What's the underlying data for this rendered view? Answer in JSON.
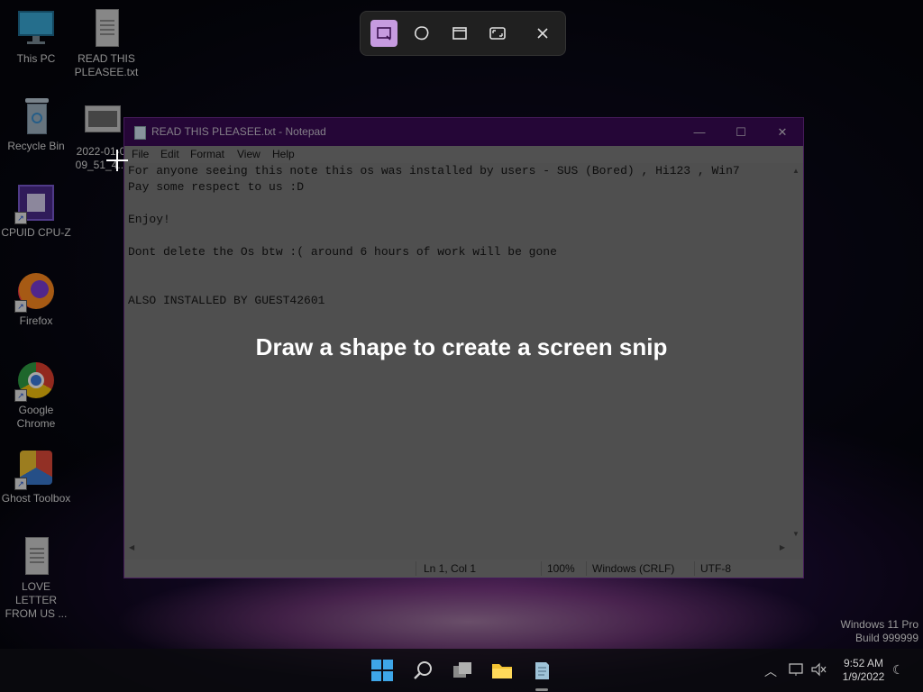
{
  "desktop": {
    "icons": [
      {
        "label": "This PC"
      },
      {
        "label": "READ THIS PLEASEE.txt"
      },
      {
        "label": "Recycle Bin"
      },
      {
        "label": "2022-01-0 09_51_4..."
      },
      {
        "label": "CPUID CPU-Z"
      },
      {
        "label": "Firefox"
      },
      {
        "label": "Google Chrome"
      },
      {
        "label": "Ghost Toolbox"
      },
      {
        "label": "LOVE LETTER FROM US ..."
      }
    ]
  },
  "notepad": {
    "title": "READ THIS PLEASEE.txt - Notepad",
    "menu": [
      "File",
      "Edit",
      "Format",
      "View",
      "Help"
    ],
    "content": "For anyone seeing this note this os was installed by users - SUS (Bored) , Hi123 , Win7\nPay some respect to us :D\n\nEnjoy!\n\nDont delete the Os btw :( around 6 hours of work will be gone\n\n\nALSO INSTALLED BY GUEST42601",
    "status": {
      "position": "Ln 1, Col 1",
      "zoom": "100%",
      "line_ending": "Windows (CRLF)",
      "encoding": "UTF-8"
    },
    "buttons": {
      "minimize": "—",
      "maximize": "☐",
      "close": "✕"
    }
  },
  "snip": {
    "hint": "Draw a shape to create a screen snip",
    "tools": [
      "rectangle-snip",
      "freeform-snip",
      "window-snip",
      "fullscreen-snip",
      "close"
    ],
    "active_tool": "rectangle-snip",
    "accent_color": "#c69be0"
  },
  "system": {
    "edition_line1": "Windows 11 Pro",
    "edition_line2": "Build 999999",
    "time": "9:52 AM",
    "date": "1/9/2022"
  }
}
